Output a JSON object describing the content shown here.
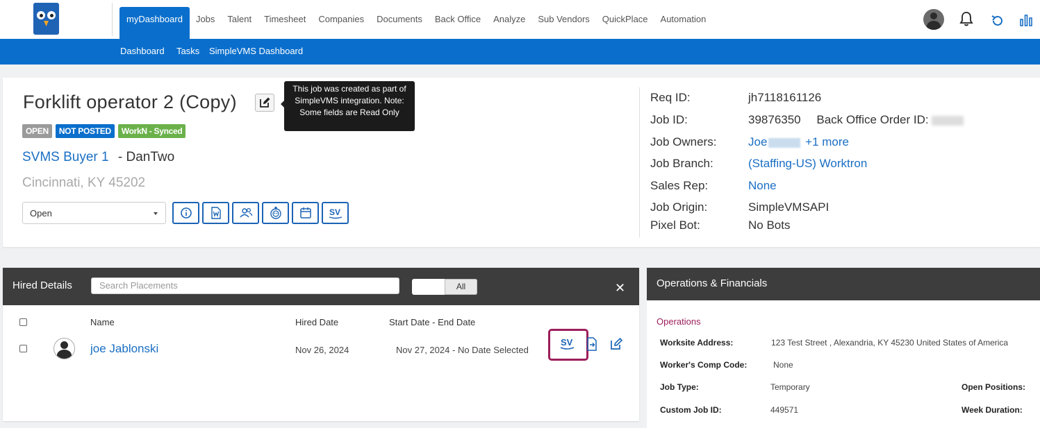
{
  "nav": {
    "items": [
      "myDashboard",
      "Jobs",
      "Talent",
      "Timesheet",
      "Companies",
      "Documents",
      "Back Office",
      "Analyze",
      "Sub Vendors",
      "QuickPlace",
      "Automation"
    ],
    "sub_items": [
      "Dashboard",
      "Tasks",
      "SimpleVMS Dashboard"
    ]
  },
  "job": {
    "title": "Forklift operator 2 (Copy)",
    "tooltip": "This job was created as part of SimpleVMS integration. Note: Some fields are Read Only",
    "badges": [
      "OPEN",
      "NOT POSTED",
      "WorkN - Synced"
    ],
    "buyer": "SVMS Buyer 1",
    "buyer_rest": "- DanTwo",
    "location": "Cincinnati, KY 45202",
    "status": "Open"
  },
  "req": {
    "req_id_label": "Req ID:",
    "req_id": "jh7118161126",
    "job_id_label": "Job ID:",
    "job_id": "39876350",
    "back_office_label": "Back Office Order ID:",
    "owners_label": "Job Owners:",
    "owners": "Joe",
    "owners_more": "+1 more",
    "branch_label": "Job Branch:",
    "branch": "(Staffing-US) Worktron",
    "sales_label": "Sales Rep:",
    "sales": "None",
    "origin_label": "Job Origin:",
    "origin": "SimpleVMSAPI",
    "pixel_label": "Pixel Bot:",
    "pixel": "No Bots"
  },
  "hired": {
    "title": "Hired Details",
    "search_placeholder": "Search Placements",
    "toggle": "All",
    "columns": [
      "Name",
      "Hired Date",
      "Start Date - End Date"
    ],
    "row": {
      "name": "joe Jablonski",
      "hired_date": "Nov 26, 2024",
      "start_date": "Nov 27, 2024",
      "sep": "-",
      "end_date": "No Date Selected"
    }
  },
  "ops": {
    "title": "Operations & Financials",
    "subtitle": "Operations",
    "worksite_label": "Worksite Address:",
    "worksite": "123 Test Street , Alexandria, KY 45230 United States of America",
    "comp_label": "Worker's Comp Code:",
    "comp": "None",
    "type_label": "Job Type:",
    "type": "Temporary",
    "open_pos_label": "Open Positions:",
    "custom_label": "Custom Job ID:",
    "custom": "449571",
    "week_label": "Week Duration:"
  },
  "colors": {
    "primary": "#0a6fcc",
    "link": "#1a6fc4",
    "header_dark": "#3d3d3d",
    "accent": "#9c1e5b"
  }
}
